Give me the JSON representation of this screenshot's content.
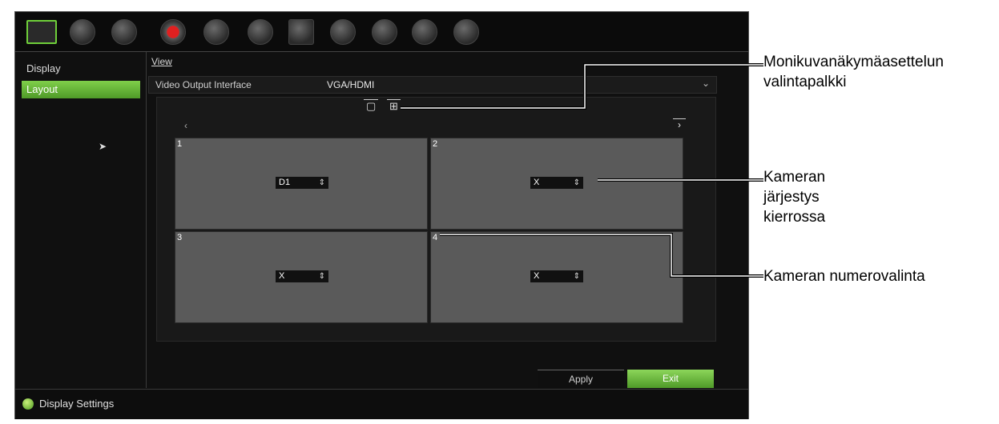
{
  "topbar": {
    "icons": [
      "display-icon",
      "camera-icon",
      "network-icon",
      "record-icon",
      "alarm-icon",
      "device-icon",
      "hdd-icon",
      "user-icon",
      "system-info-icon",
      "help-icon",
      "shutdown-icon"
    ]
  },
  "sidebar": {
    "items": [
      {
        "label": "Display",
        "active": false
      },
      {
        "label": "Layout",
        "active": true
      }
    ]
  },
  "main": {
    "tab": "View",
    "output_interface": {
      "label": "Video Output Interface",
      "value": "VGA/HDMI"
    },
    "cells": [
      {
        "number": "1",
        "camera": "D1"
      },
      {
        "number": "2",
        "camera": "X"
      },
      {
        "number": "3",
        "camera": "X"
      },
      {
        "number": "4",
        "camera": "X"
      }
    ],
    "nav_left": "‹",
    "nav_right": "›"
  },
  "buttons": {
    "apply": "Apply",
    "exit": "Exit"
  },
  "status": {
    "text": "Display Settings"
  },
  "callouts": [
    {
      "text": "Monikuvanäkymäasettelun valintapalkki"
    },
    {
      "text": "Kameran järjestys kierrossa"
    },
    {
      "text": "Kameran numerovalinta"
    }
  ],
  "colors": {
    "accent_green": "#6fcf3a",
    "background": "#101010",
    "cell": "#5a5a5a"
  }
}
